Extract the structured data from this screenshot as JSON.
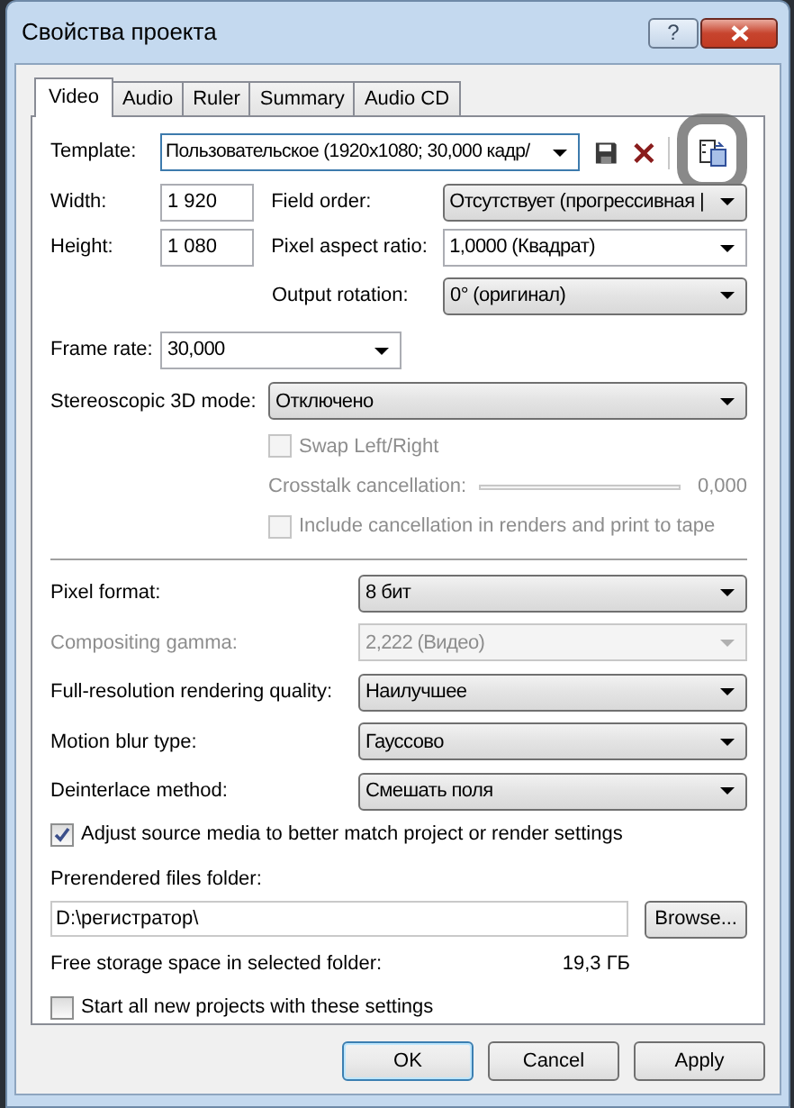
{
  "window": {
    "title": "Свойства проекта",
    "help_button": "?"
  },
  "tabs": [
    {
      "label": "Video",
      "selected": true
    },
    {
      "label": "Audio",
      "selected": false
    },
    {
      "label": "Ruler",
      "selected": false
    },
    {
      "label": "Summary",
      "selected": false
    },
    {
      "label": "Audio CD",
      "selected": false
    }
  ],
  "template": {
    "label": "Template:",
    "value": "Пользовательское (1920x1080; 30,000 кадр/"
  },
  "width": {
    "label": "Width:",
    "value": "1 920"
  },
  "height": {
    "label": "Height:",
    "value": "1 080"
  },
  "field_order": {
    "label": "Field order:",
    "value": "Отсутствует (прогрессивная |",
    "kind": "list"
  },
  "pixel_aspect_ratio": {
    "label": "Pixel aspect ratio:",
    "value": "1,0000 (Квадрат)",
    "kind": "editable"
  },
  "output_rotation": {
    "label": "Output rotation:",
    "value": "0° (оригинал)",
    "kind": "list"
  },
  "frame_rate": {
    "label": "Frame rate:",
    "value": "30,000",
    "kind": "editable"
  },
  "stereoscopic_3d_mode": {
    "label": "Stereoscopic 3D mode:",
    "value": "Отключено",
    "kind": "list"
  },
  "swap_left_right": {
    "label": "Swap Left/Right",
    "checked": false,
    "disabled": true
  },
  "crosstalk_cancellation": {
    "label": "Crosstalk cancellation:",
    "reading": "0,000",
    "disabled": true
  },
  "include_cancellation": {
    "label": "Include cancellation in renders and print to tape",
    "checked": false,
    "disabled": true
  },
  "render_settings": [
    {
      "label": "Pixel format:",
      "value": "8 бит",
      "disabled": false
    },
    {
      "label": "Compositing gamma:",
      "value": "2,222 (Видео)",
      "disabled": true
    },
    {
      "label": "Full-resolution rendering quality:",
      "value": "Наилучшее",
      "disabled": false
    },
    {
      "label": "Motion blur type:",
      "value": "Гауссово",
      "disabled": false
    },
    {
      "label": "Deinterlace method:",
      "value": "Смешать поля",
      "disabled": false
    }
  ],
  "adjust_source_media": {
    "label": "Adjust source media to better match project or render settings",
    "checked": true,
    "disabled": false
  },
  "prerendered_folder": {
    "label": "Prerendered files folder:",
    "value": "D:\\регистратор\\",
    "browse_button": "Browse..."
  },
  "free_storage": {
    "label": "Free storage space in selected folder:",
    "value": "19,3 ГБ"
  },
  "start_all_new": {
    "label": "Start all new projects with these settings",
    "checked": false,
    "disabled": false
  },
  "buttons": [
    {
      "label": "OK",
      "default": true
    },
    {
      "label": "Cancel",
      "default": false
    },
    {
      "label": "Apply",
      "default": false
    }
  ]
}
